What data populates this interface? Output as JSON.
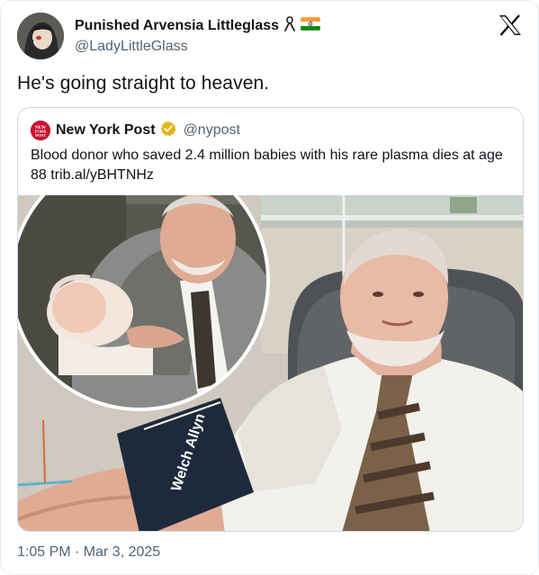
{
  "author": {
    "display_name": "Punished Arvensia Littleglass",
    "handle": "@LadyLittleGlass",
    "flag_emoji_icons": [
      "ribbon-icon",
      "india-flag-icon"
    ]
  },
  "tweet": {
    "text": "He's going straight to heaven.",
    "timestamp": "1:05 PM · Mar 3, 2025"
  },
  "quoted": {
    "display_name": "New York Post",
    "handle": "@nypost",
    "verified": true,
    "text": "Blood donor who saved 2.4 million babies with his rare plasma dies at age 88 trib.al/yBHTNHz",
    "avatar_text": "NEW YORK POST"
  },
  "colors": {
    "text_primary": "#0f1419",
    "text_secondary": "#536471",
    "border": "#cfd9de",
    "verified_gold": "#e2b719",
    "nypost_red": "#c8102e"
  }
}
